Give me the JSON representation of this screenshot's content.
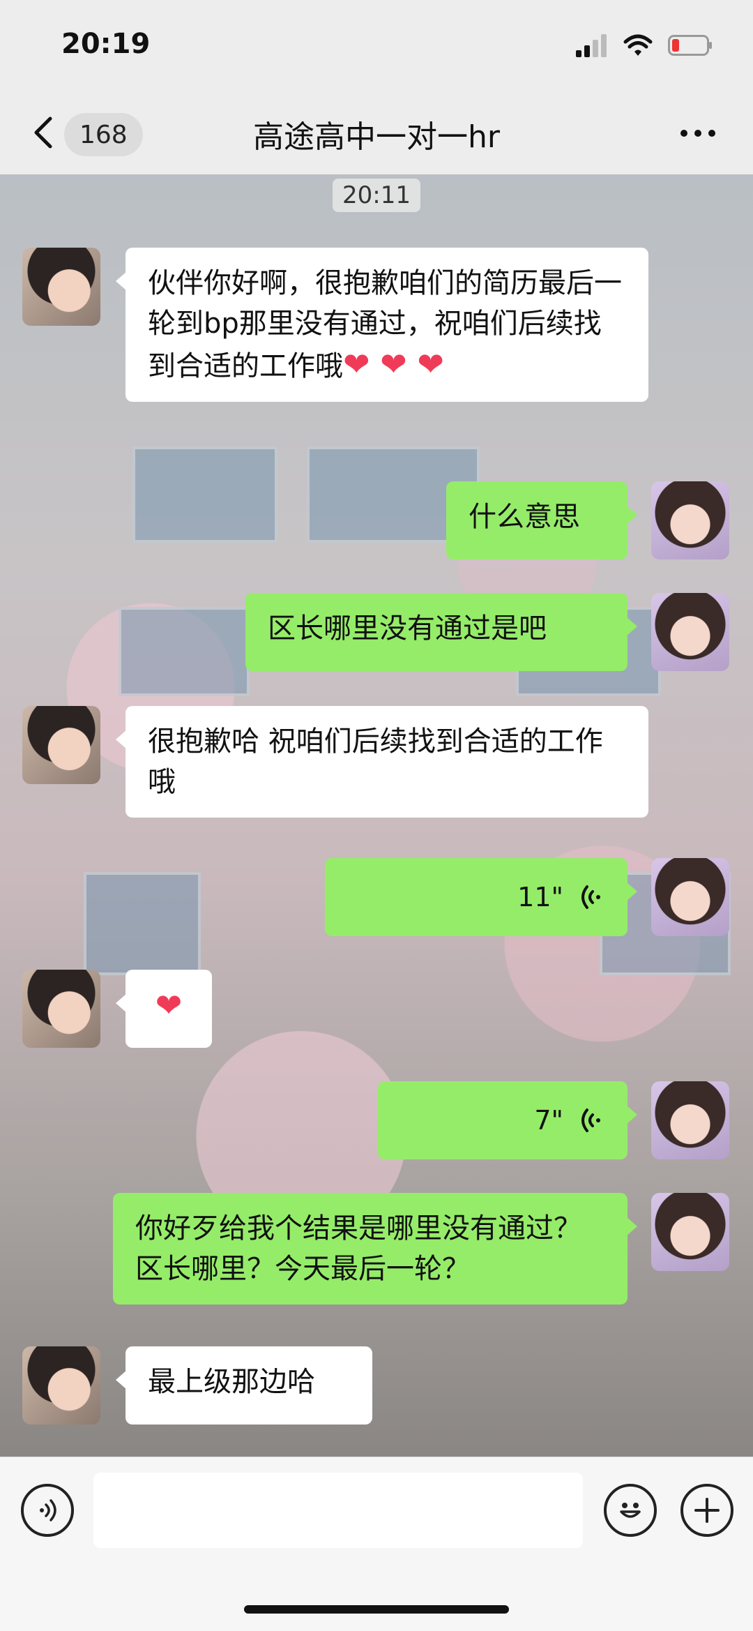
{
  "status": {
    "time": "20:19"
  },
  "nav": {
    "unread_count": "168",
    "title": "高途高中一对一hr"
  },
  "chat": {
    "timestamp": "20:11",
    "messages": [
      {
        "side": "in",
        "text": "伙伴你好啊，很抱歉咱们的简历最后一轮到bp那里没有通过，祝咱们后续找到合适的工作哦",
        "hearts": "❤ ❤ ❤"
      },
      {
        "side": "out",
        "text": "什么意思"
      },
      {
        "side": "out",
        "text": "区长哪里没有通过是吧"
      },
      {
        "side": "in",
        "text": "很抱歉哈 祝咱们后续找到合适的工作哦"
      },
      {
        "side": "out",
        "voice_duration": "11\""
      },
      {
        "side": "in",
        "hearts": "❤"
      },
      {
        "side": "out",
        "voice_duration": "7\""
      },
      {
        "side": "out",
        "text": "你好歹给我个结果是哪里没有通过？区长哪里？今天最后一轮？"
      },
      {
        "side": "in",
        "text": "最上级那边哈"
      }
    ]
  },
  "input": {
    "value": ""
  },
  "icons": {
    "back": "chevron-left-icon",
    "more": "more-dots-icon",
    "voice": "voice-wave-icon",
    "emoji": "smiley-icon",
    "plus": "plus-icon"
  },
  "colors": {
    "outgoing_bubble": "#95ec69",
    "incoming_bubble": "#ffffff",
    "heart": "#ef3b57"
  }
}
